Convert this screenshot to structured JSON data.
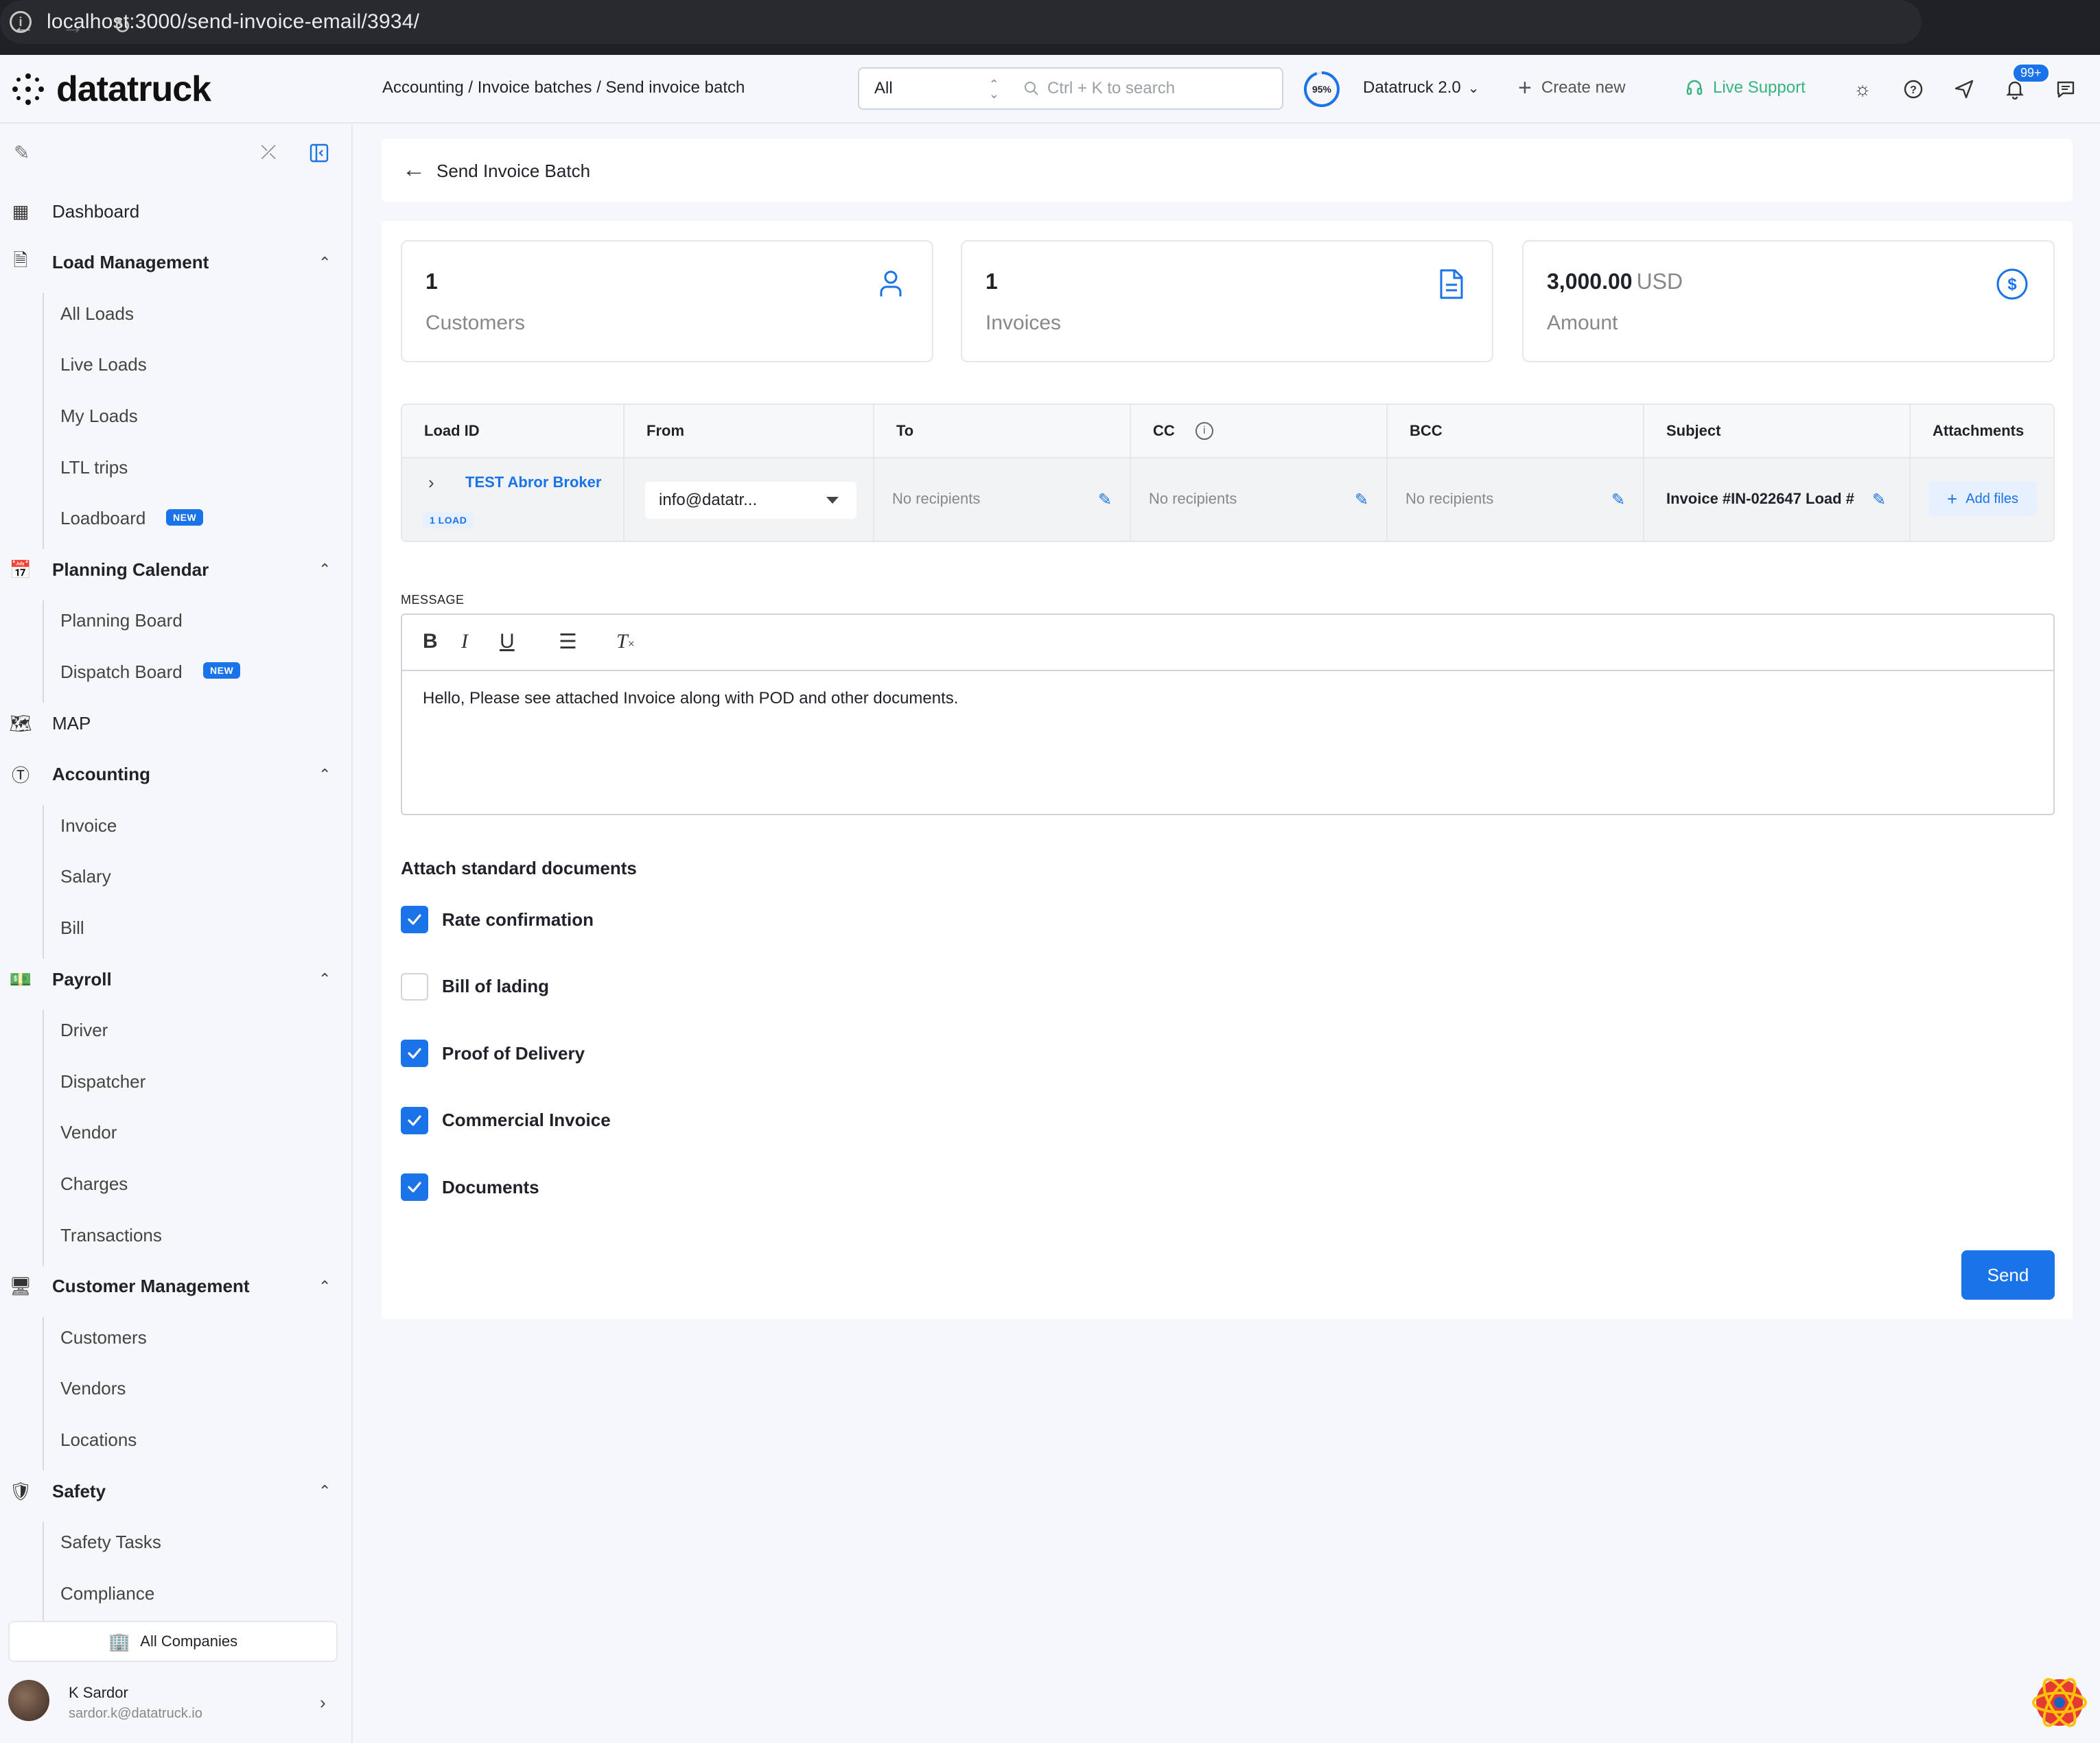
{
  "browser": {
    "url": "localhost:3000/send-invoice-email/3934/"
  },
  "header": {
    "logo_text": "datatruck",
    "breadcrumb": "Accounting / Invoice batches / Send invoice batch",
    "scope_value": "All",
    "search_placeholder": "Ctrl + K to search",
    "progress_percent": 95,
    "progress_label": "95%",
    "version": "Datatruck 2.0",
    "create_new": "Create new",
    "live_support": "Live Support",
    "notifications_badge": "99+"
  },
  "sidebar": {
    "top": [
      {
        "label": "Dashboard",
        "icon": "dashboard-icon"
      }
    ],
    "groups": [
      {
        "label": "Load Management",
        "icon": "document-icon",
        "children": [
          "All Loads",
          "Live Loads",
          "My Loads",
          "LTL trips",
          "Loadboard"
        ]
      },
      {
        "label": "Planning Calendar",
        "icon": "calendar-icon",
        "children": [
          "Planning Board",
          "Dispatch Board"
        ]
      },
      {
        "label": "MAP",
        "icon": "map-icon",
        "children": []
      },
      {
        "label": "Accounting",
        "icon": "dollar-icon",
        "children": [
          "Invoice",
          "Salary",
          "Bill"
        ]
      },
      {
        "label": "Payroll",
        "icon": "payroll-icon",
        "children": [
          "Driver",
          "Dispatcher",
          "Vendor",
          "Charges",
          "Transactions"
        ]
      },
      {
        "label": "Customer Management",
        "icon": "monitor-icon",
        "children": [
          "Customers",
          "Vendors",
          "Locations"
        ]
      },
      {
        "label": "Safety",
        "icon": "shield-icon",
        "children": [
          "Safety Tasks",
          "Compliance"
        ]
      }
    ],
    "new_badge": "NEW",
    "all_companies": "All Companies",
    "user": {
      "name": "K Sardor",
      "email": "sardor.k@datatruck.io"
    }
  },
  "page": {
    "title": "Send Invoice Batch",
    "stats": [
      {
        "value": "1",
        "unit": "",
        "label": "Customers",
        "icon": "user-icon"
      },
      {
        "value": "1",
        "unit": "",
        "label": "Invoices",
        "icon": "invoice-icon"
      },
      {
        "value": "3,000.00",
        "unit": "USD",
        "label": "Amount",
        "icon": "dollar-circle-icon"
      }
    ],
    "table": {
      "headers": [
        "Load ID",
        "From",
        "To",
        "CC",
        "BCC",
        "Subject",
        "Attachments"
      ],
      "row": {
        "customer": "TEST Abror Broker",
        "load_badge": "1 LOAD",
        "from": "info@datatr...",
        "to": "No recipients",
        "cc": "No recipients",
        "bcc": "No recipients",
        "subject": "Invoice #IN-022647 Load #",
        "attachments_button": "Add files"
      }
    },
    "message_label": "MESSAGE",
    "message_text": "Hello, Please see attached Invoice along with POD and other documents.",
    "docs_title": "Attach standard documents",
    "documents": [
      {
        "label": "Rate confirmation",
        "checked": true
      },
      {
        "label": "Bill of lading",
        "checked": false
      },
      {
        "label": "Proof of Delivery",
        "checked": true
      },
      {
        "label": "Commercial Invoice",
        "checked": true
      },
      {
        "label": "Documents",
        "checked": true
      }
    ],
    "send_button": "Send"
  },
  "colors": {
    "accent": "#1a73e8",
    "support_green": "#36b37e",
    "muted_text": "#888888"
  }
}
